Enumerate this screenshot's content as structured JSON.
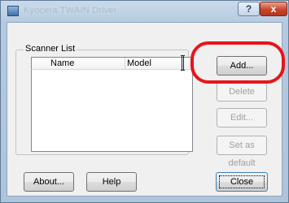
{
  "window": {
    "title": "Kyocera TWAIN Driver",
    "help_glyph": "?",
    "close_glyph": "x"
  },
  "scanner_list": {
    "group_label": "Scanner List",
    "columns": [
      "Name",
      "Model"
    ]
  },
  "buttons": {
    "add": "Add...",
    "delete": "Delete",
    "edit": "Edit...",
    "set_default": "Set as default",
    "about": "About...",
    "help": "Help",
    "close": "Close"
  },
  "colors": {
    "highlight": "#e8141b",
    "close_button": "#c8452d"
  }
}
